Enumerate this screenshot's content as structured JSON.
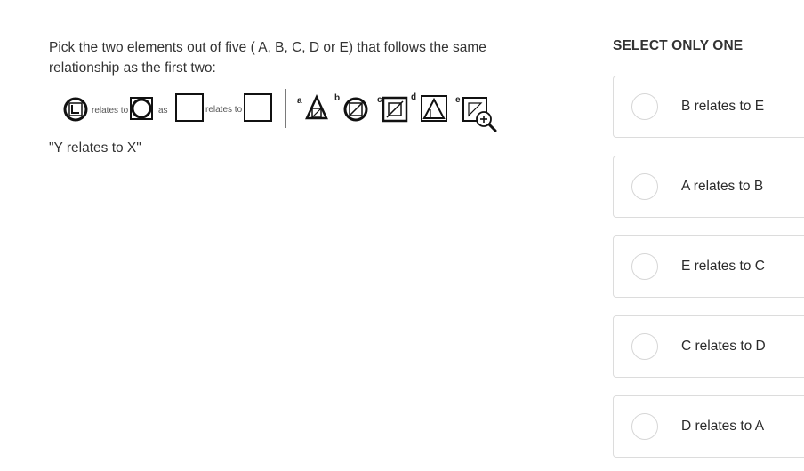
{
  "question": {
    "text": "Pick the two elements out of five ( A, B, C, D or E) that follows the same relationship as the first two:",
    "hint": "\"Y relates to X\""
  },
  "figure": {
    "relates_to_1": "relates to",
    "as": "as",
    "relates_to_2": "relates to",
    "letters": [
      "a",
      "b",
      "c",
      "d",
      "e"
    ],
    "zoom_icon": "zoom-in-icon"
  },
  "panel": {
    "title": "SELECT ONLY ONE",
    "options": [
      {
        "label": "B relates to E"
      },
      {
        "label": "A relates to B"
      },
      {
        "label": "E relates to C"
      },
      {
        "label": "C relates to D"
      },
      {
        "label": "D relates to A"
      }
    ]
  }
}
